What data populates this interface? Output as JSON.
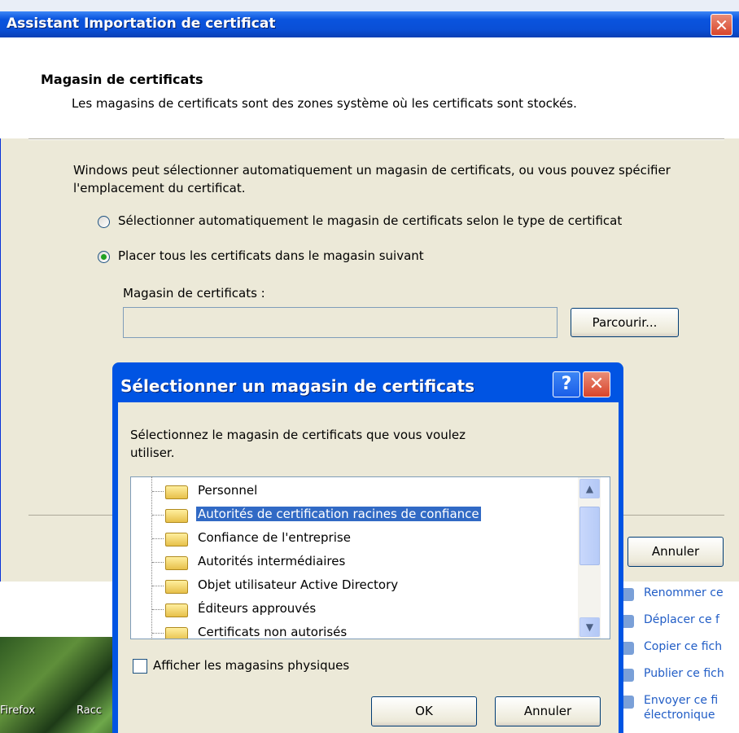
{
  "wizard": {
    "title": "Assistant Importation de certificat",
    "close_glyph": "✕",
    "header_title": "Magasin de certificats",
    "header_description": "Les magasins de certificats sont des zones système où les certificats sont stockés.",
    "body_text": "Windows peut sélectionner automatiquement un magasin de certificats, ou vous pouvez spécifier l'emplacement du certificat.",
    "radio_auto_label": "Sélectionner automatiquement le magasin de certificats selon le type de certificat",
    "radio_manual_label": "Placer tous les certificats dans le magasin suivant",
    "selected_option": "manual",
    "store_field_label": "Magasin de certificats :",
    "store_field_value": "",
    "browse_button": "Parcourir...",
    "cancel_button": "Annuler"
  },
  "dialog": {
    "title": "Sélectionner un magasin de certificats",
    "help_glyph": "?",
    "close_glyph": "✕",
    "description": "Sélectionnez le magasin de certificats que vous voulez utiliser.",
    "stores": [
      {
        "label": "Personnel",
        "selected": false
      },
      {
        "label": "Autorités de certification racines de confiance",
        "selected": true
      },
      {
        "label": "Confiance de l'entreprise",
        "selected": false
      },
      {
        "label": "Autorités intermédiaires",
        "selected": false
      },
      {
        "label": "Objet utilisateur Active Directory",
        "selected": false
      },
      {
        "label": "Éditeurs approuvés",
        "selected": false
      },
      {
        "label": "Certificats non autorisés",
        "selected": false
      }
    ],
    "scroll_up_glyph": "▲",
    "scroll_down_glyph": "▼",
    "checkbox_label": "Afficher les magasins physiques",
    "checkbox_checked": false,
    "ok_button": "OK",
    "cancel_button": "Annuler"
  },
  "background": {
    "desktop_icons": [
      "Firefox",
      "Racc"
    ],
    "task_links": [
      "Renommer ce",
      "Déplacer ce f",
      "Copier ce fich",
      "Publier ce fich",
      "Envoyer ce fi",
      "électronique"
    ]
  },
  "colors": {
    "titlebar": "#0a54de",
    "selection": "#316ac5",
    "dialog_face": "#ece9d8",
    "link": "#215dc6"
  }
}
